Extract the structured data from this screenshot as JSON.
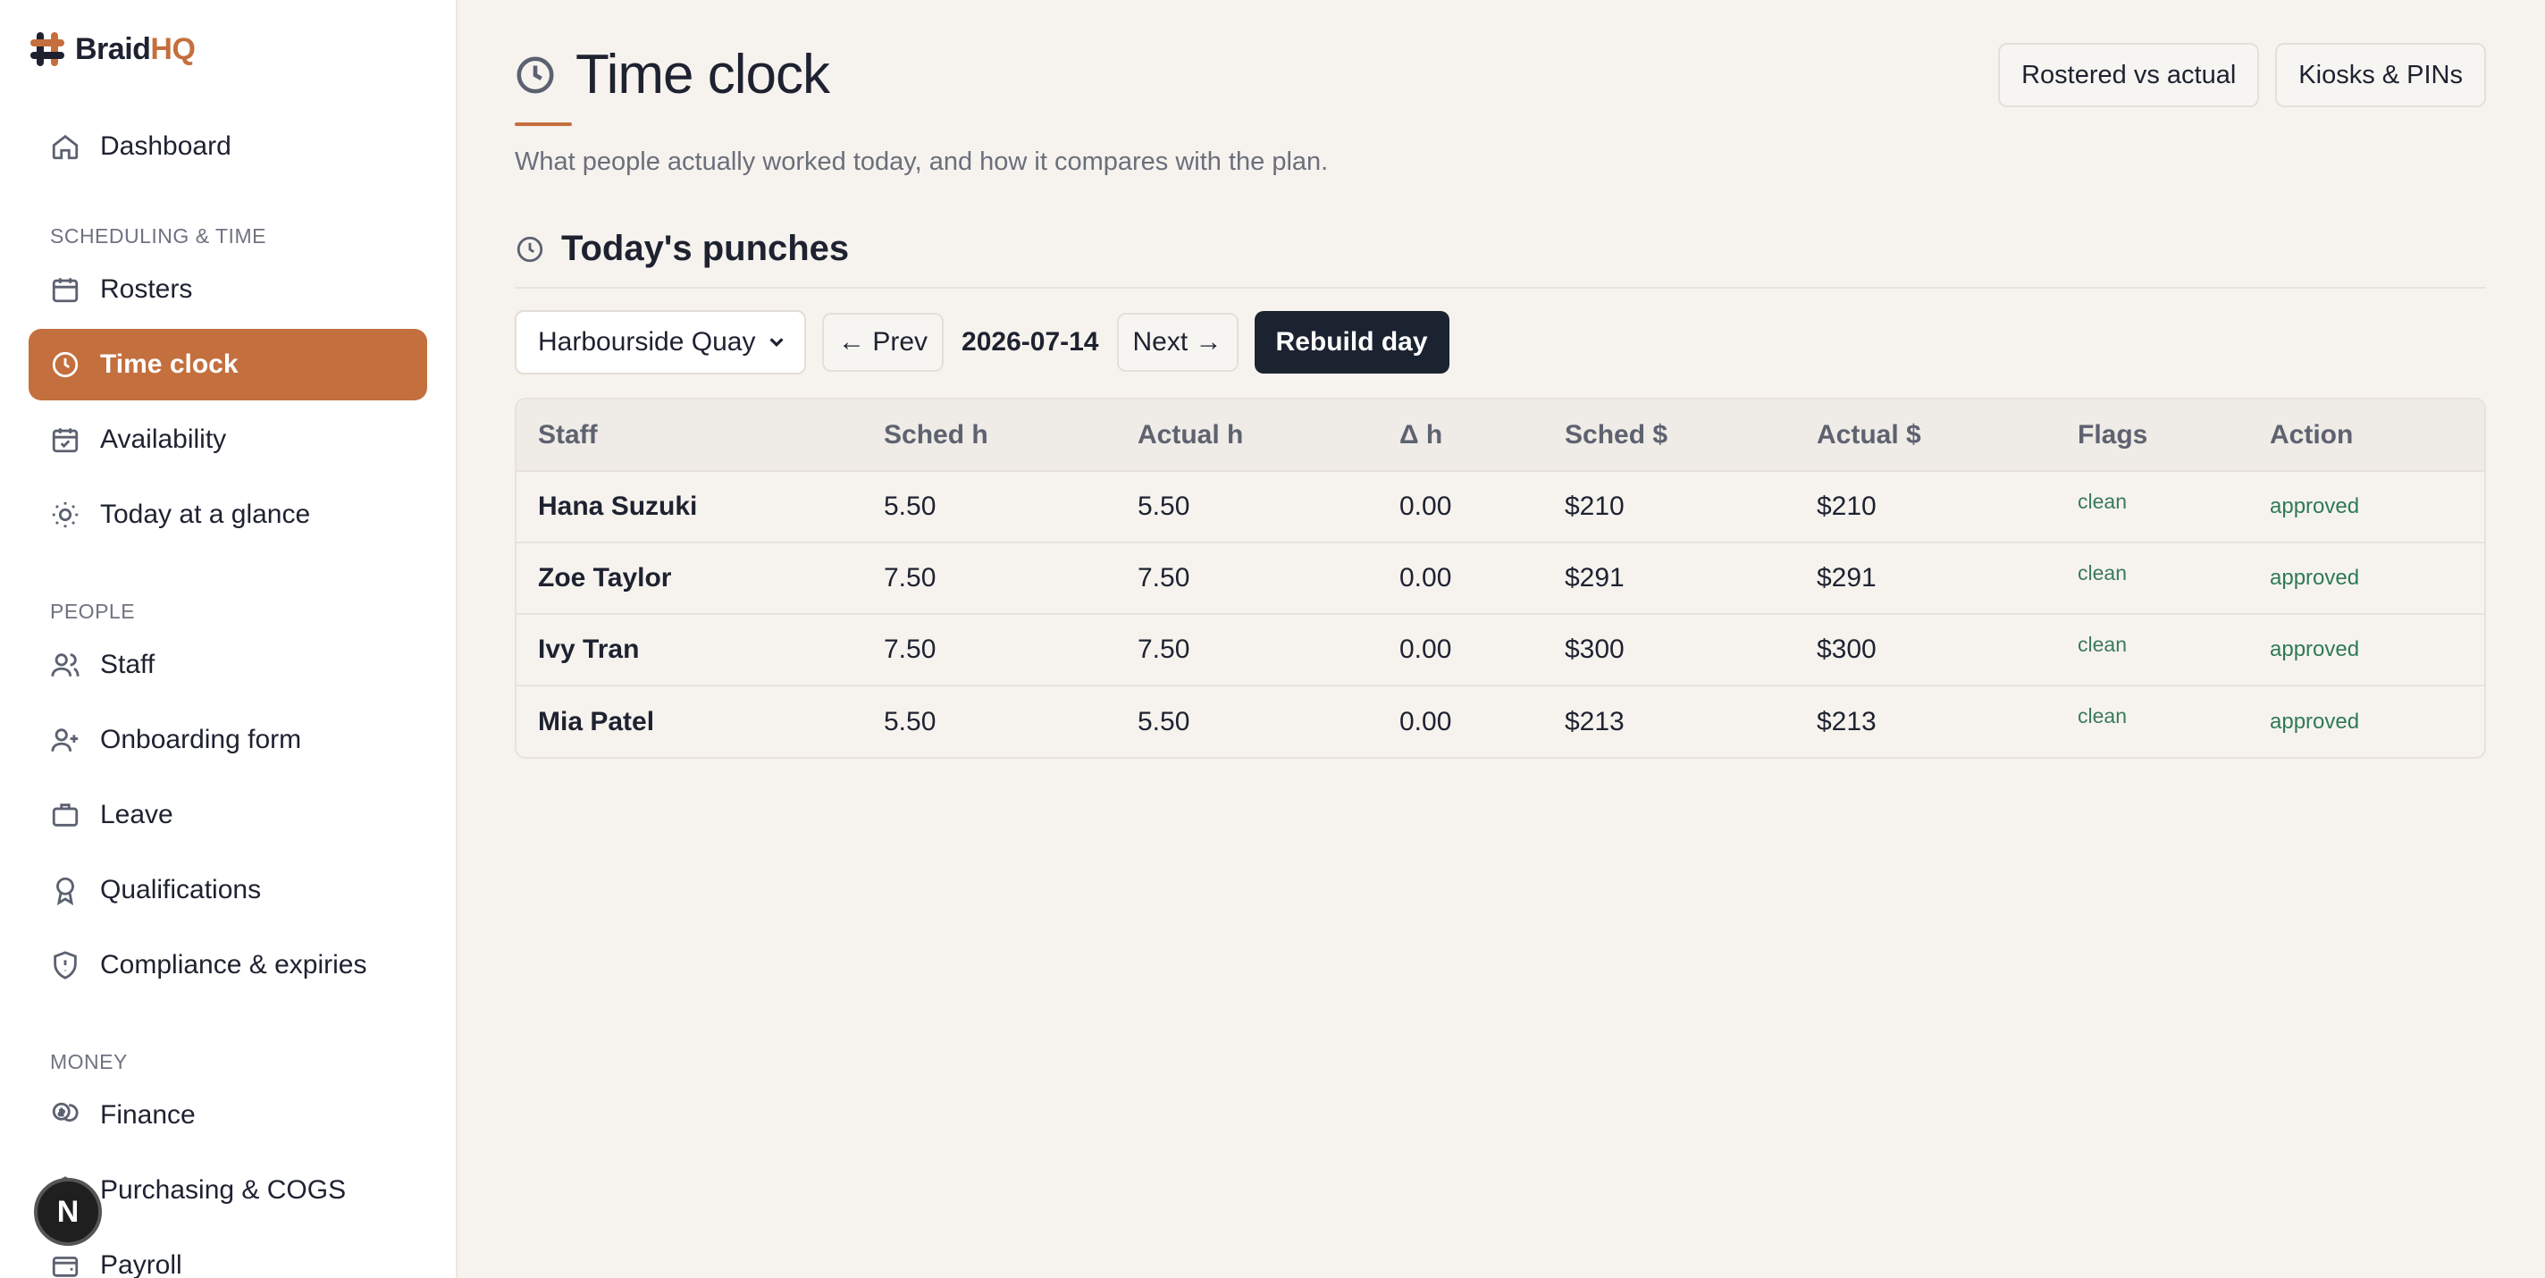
{
  "app": {
    "brand_main": "Braid",
    "brand_accent": "HQ"
  },
  "colors": {
    "accent": "#c46f3e",
    "dark": "#1b2230",
    "ok_green": "#2f7a55"
  },
  "sidebar": {
    "top_item": {
      "label": "Dashboard",
      "icon": "home-icon"
    },
    "sections": [
      {
        "title": "SCHEDULING & TIME",
        "items": [
          {
            "label": "Rosters",
            "icon": "calendar-icon"
          },
          {
            "label": "Time clock",
            "icon": "clock-icon",
            "active": true
          },
          {
            "label": "Availability",
            "icon": "calendar-check-icon"
          },
          {
            "label": "Today at a glance",
            "icon": "sun-icon"
          }
        ]
      },
      {
        "title": "PEOPLE",
        "items": [
          {
            "label": "Staff",
            "icon": "users-icon"
          },
          {
            "label": "Onboarding form",
            "icon": "user-plus-icon"
          },
          {
            "label": "Leave",
            "icon": "briefcase-icon"
          },
          {
            "label": "Qualifications",
            "icon": "award-icon"
          },
          {
            "label": "Compliance & expiries",
            "icon": "shield-icon"
          }
        ]
      },
      {
        "title": "MONEY",
        "items": [
          {
            "label": "Finance",
            "icon": "coins-icon"
          },
          {
            "label": "Purchasing & COGS",
            "icon": "box-icon"
          },
          {
            "label": "Payroll",
            "icon": "wallet-icon"
          }
        ]
      }
    ],
    "floating_badge": "N"
  },
  "header": {
    "title": "Time clock",
    "subtitle": "What people actually worked today, and how it compares with the plan.",
    "buttons": [
      "Rostered vs actual",
      "Kiosks & PINs"
    ]
  },
  "punches": {
    "section_title": "Today's punches",
    "location": "Harbourside Quay",
    "prev_label": "← Prev",
    "date": "2026-07-14",
    "next_label": "Next →",
    "rebuild_label": "Rebuild day",
    "columns": [
      "Staff",
      "Sched h",
      "Actual h",
      "Δ h",
      "Sched $",
      "Actual $",
      "Flags",
      "Action"
    ],
    "rows": [
      {
        "staff": "Hana Suzuki",
        "sched_h": "5.50",
        "actual_h": "5.50",
        "delta_h": "0.00",
        "sched_cost": "$210",
        "actual_cost": "$210",
        "flags": "clean",
        "action": "approved"
      },
      {
        "staff": "Zoe Taylor",
        "sched_h": "7.50",
        "actual_h": "7.50",
        "delta_h": "0.00",
        "sched_cost": "$291",
        "actual_cost": "$291",
        "flags": "clean",
        "action": "approved"
      },
      {
        "staff": "Ivy Tran",
        "sched_h": "7.50",
        "actual_h": "7.50",
        "delta_h": "0.00",
        "sched_cost": "$300",
        "actual_cost": "$300",
        "flags": "clean",
        "action": "approved"
      },
      {
        "staff": "Mia Patel",
        "sched_h": "5.50",
        "actual_h": "5.50",
        "delta_h": "0.00",
        "sched_cost": "$213",
        "actual_cost": "$213",
        "flags": "clean",
        "action": "approved"
      }
    ]
  }
}
